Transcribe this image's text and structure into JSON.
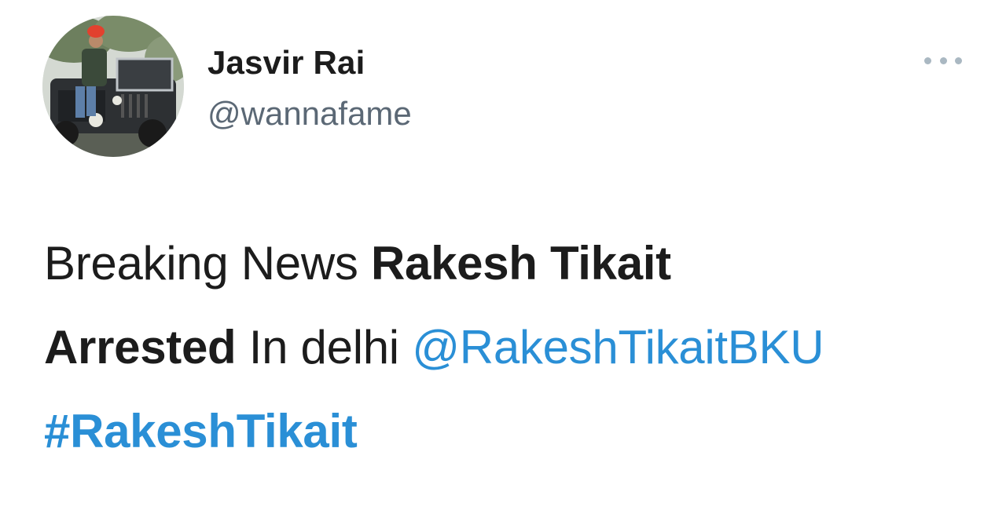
{
  "author": {
    "display_name": "Jasvir Rai",
    "handle": "@wannafame",
    "avatar_icon": "profile-photo"
  },
  "more_icon": "more-options-icon",
  "tweet": {
    "part1": "Breaking News ",
    "part2_bold": "Rakesh Tikait",
    "part3_bold": "Arrested",
    "part4": " In delhi ",
    "mention": "@RakeshTikaitBKU",
    "hashtag": "#RakeshTikait"
  },
  "colors": {
    "link": "#2a8fd6",
    "text": "#1c1c1c",
    "handle": "#5b6875"
  }
}
